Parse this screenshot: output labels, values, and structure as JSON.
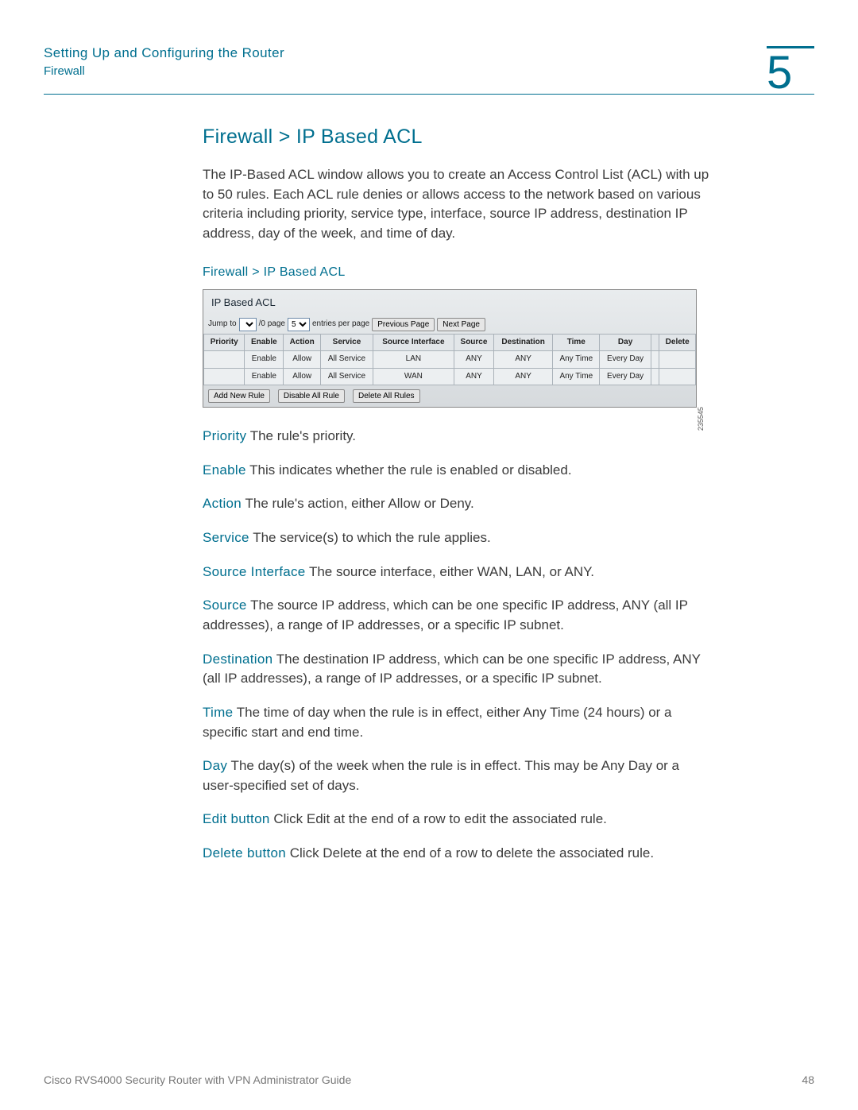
{
  "header": {
    "section": "Setting Up and Configuring the Router",
    "subsection": "Firewall",
    "chapter": "5"
  },
  "main": {
    "title": "Firewall > IP Based ACL",
    "intro": "The IP-Based ACL window allows you to create an Access Control List (ACL) with up to 50 rules. Each ACL rule denies or allows access to the network based on various criteria including priority, service type, interface, source IP address, destination IP address, day of the week, and time of day.",
    "caption": "Firewall > IP Based ACL"
  },
  "widget": {
    "panel_title": "IP Based ACL",
    "jump_label": "Jump to",
    "page_sep": "/0 page",
    "entries_label": "entries per page",
    "jump_val": "",
    "per_page_val": "5",
    "prev_page": "Previous Page",
    "next_page": "Next Page",
    "headers": [
      "Priority",
      "Enable",
      "Action",
      "Service",
      "Source Interface",
      "Source",
      "Destination",
      "Time",
      "Day",
      "",
      "Delete"
    ],
    "rows": [
      [
        "",
        "Enable",
        "Allow",
        "All Service",
        "LAN",
        "ANY",
        "ANY",
        "Any Time",
        "Every Day",
        "",
        ""
      ],
      [
        "",
        "Enable",
        "Allow",
        "All Service",
        "WAN",
        "ANY",
        "ANY",
        "Any Time",
        "Every Day",
        "",
        ""
      ]
    ],
    "add_btn": "Add New Rule",
    "disable_btn": "Disable All Rule",
    "delete_btn": "Delete All Rules",
    "fig_no": "235545"
  },
  "defs": [
    {
      "term": "Priority",
      "desc": " The rule's priority."
    },
    {
      "term": "Enable",
      "desc": " This indicates whether the rule is enabled or disabled."
    },
    {
      "term": "Action",
      "desc": " The rule's action, either Allow or Deny."
    },
    {
      "term": "Service",
      "desc": " The service(s) to which the rule applies."
    },
    {
      "term": "Source Interface",
      "desc": " The source interface, either WAN, LAN, or ANY."
    },
    {
      "term": "Source",
      "desc": " The source IP address, which can be one specific IP address, ANY (all IP addresses), a range of IP addresses, or a specific IP subnet."
    },
    {
      "term": "Destination",
      "desc": " The destination IP address, which can be one specific IP address, ANY (all IP addresses), a range of IP addresses, or a specific IP subnet."
    },
    {
      "term": "Time",
      "desc": " The time of day when the rule is in effect, either Any Time (24 hours) or a specific start and end time."
    },
    {
      "term": "Day",
      "desc": " The day(s) of the week when the rule is in effect. This may be Any Day or a user-specified set of days."
    },
    {
      "term": "Edit button",
      "desc": " Click Edit at the end of a row to edit the associated rule."
    },
    {
      "term": "Delete button",
      "desc": " Click Delete at the end of a row to delete the associated rule."
    }
  ],
  "footer": {
    "book": "Cisco RVS4000 Security Router with VPN Administrator Guide",
    "page": "48"
  }
}
